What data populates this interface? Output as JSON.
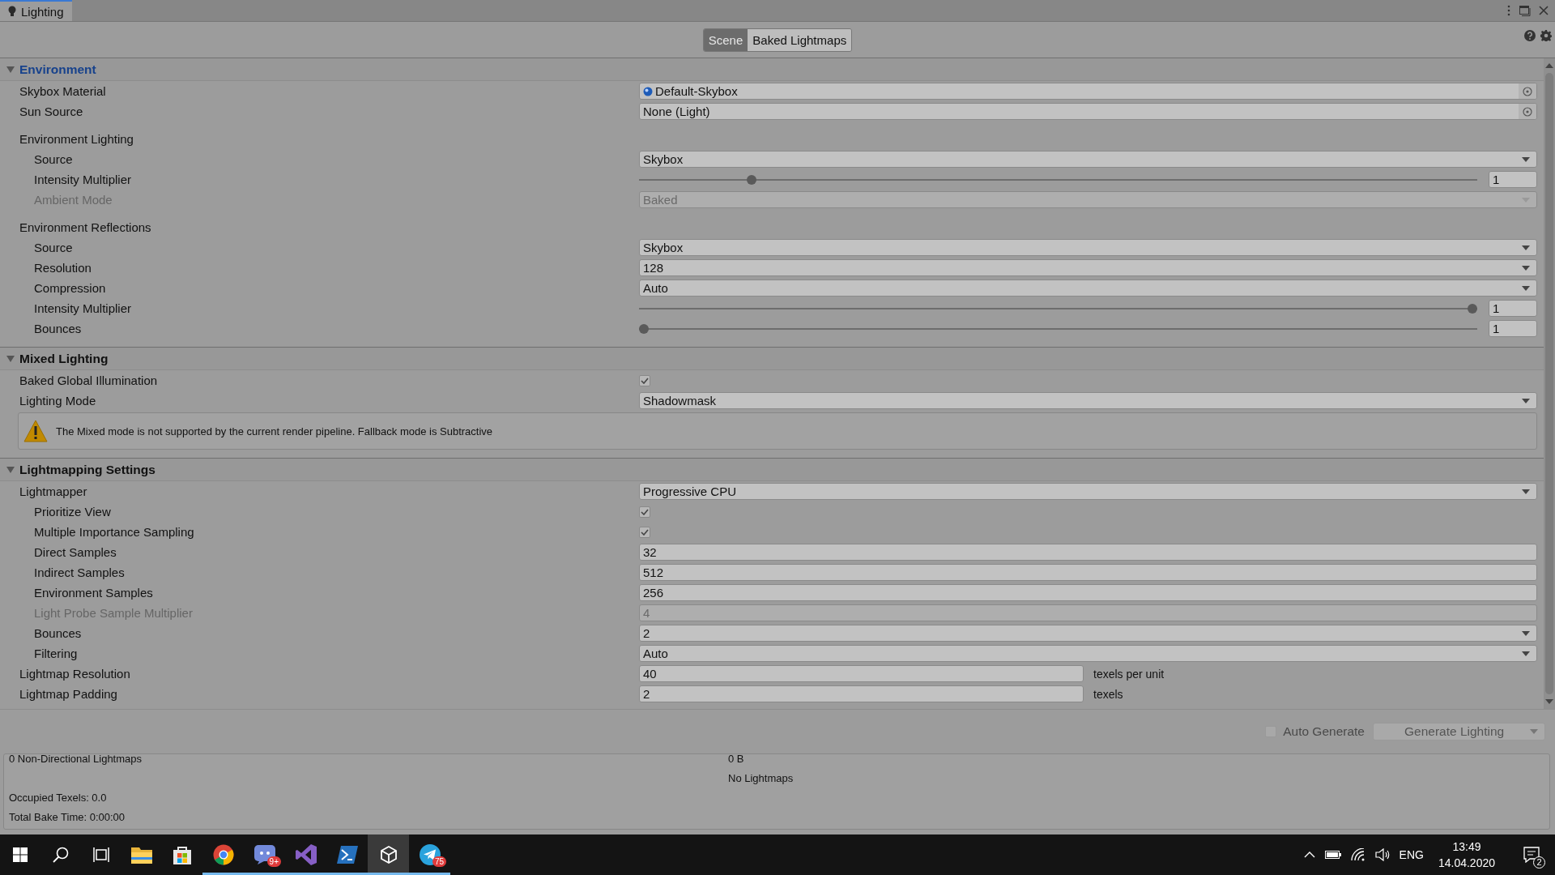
{
  "window": {
    "tab": {
      "label": "Lighting",
      "selected": true
    }
  },
  "toolbar": {
    "tabs": [
      {
        "label": "Scene",
        "selected": true
      },
      {
        "label": "Baked Lightmaps",
        "selected": false
      }
    ]
  },
  "sections": [
    {
      "title": "Environment",
      "expanded": true,
      "selected": true,
      "rows": [
        {
          "kind": "object",
          "label": "Skybox Material",
          "value": "Default-Skybox",
          "has_icon": true,
          "disabled": false
        },
        {
          "kind": "object",
          "label": "Sun Source",
          "value": "None (Light)",
          "has_icon": false,
          "disabled": false
        },
        {
          "kind": "heading",
          "label": "Environment Lighting",
          "disabled": false,
          "children": [
            {
              "kind": "dropdown",
              "label": "Source",
              "value": "Skybox",
              "disabled": false
            },
            {
              "kind": "slider",
              "label": "Intensity Multiplier",
              "level": 0.13,
              "value": "1",
              "disabled": false
            },
            {
              "kind": "dropdown",
              "label": "Ambient Mode",
              "value": "Baked",
              "disabled": true
            }
          ]
        },
        {
          "kind": "heading",
          "label": "Environment Reflections",
          "disabled": false,
          "children": [
            {
              "kind": "dropdown",
              "label": "Source",
              "value": "Skybox",
              "disabled": false
            },
            {
              "kind": "dropdown",
              "label": "Resolution",
              "value": "128",
              "disabled": false
            },
            {
              "kind": "dropdown",
              "label": "Compression",
              "value": "Auto",
              "disabled": false
            },
            {
              "kind": "slider",
              "label": "Intensity Multiplier",
              "level": 1,
              "value": "1",
              "disabled": false
            },
            {
              "kind": "slider",
              "label": "Bounces",
              "level": 0,
              "value": "1",
              "disabled": false
            }
          ]
        }
      ]
    },
    {
      "title": "Mixed Lighting",
      "expanded": true,
      "selected": false,
      "rows": [
        {
          "kind": "checkbox",
          "label": "Baked Global Illumination",
          "checked": true,
          "disabled": false
        },
        {
          "kind": "dropdown",
          "label": "Lighting Mode",
          "value": "Shadowmask",
          "disabled": false
        },
        {
          "kind": "warning",
          "text": "The Mixed mode is not supported by the current render pipeline. Fallback mode is Subtractive"
        }
      ]
    },
    {
      "title": "Lightmapping Settings",
      "expanded": true,
      "selected": false,
      "rows": [
        {
          "kind": "dropdown",
          "label": "Lightmapper",
          "value": "Progressive CPU",
          "disabled": false,
          "children": [
            {
              "kind": "checkbox",
              "label": "Prioritize View",
              "checked": true,
              "disabled": false
            },
            {
              "kind": "checkbox",
              "label": "Multiple Importance Sampling",
              "checked": true,
              "disabled": false
            },
            {
              "kind": "number",
              "label": "Direct Samples",
              "value": "32",
              "disabled": false
            },
            {
              "kind": "number",
              "label": "Indirect Samples",
              "value": "512",
              "disabled": false
            },
            {
              "kind": "number",
              "label": "Environment Samples",
              "value": "256",
              "disabled": false
            },
            {
              "kind": "number",
              "label": "Light Probe Sample Multiplier",
              "value": "4",
              "disabled": true
            },
            {
              "kind": "dropdown",
              "label": "Bounces",
              "value": "2",
              "disabled": false
            },
            {
              "kind": "dropdown",
              "label": "Filtering",
              "value": "Auto",
              "disabled": false
            }
          ]
        },
        {
          "kind": "number",
          "label": "Lightmap Resolution",
          "value": "40",
          "suffix": "texels per unit",
          "disabled": false
        },
        {
          "kind": "number",
          "label": "Lightmap Padding",
          "value": "2",
          "suffix": "texels",
          "disabled": false
        }
      ]
    }
  ],
  "footer": {
    "auto_generate": {
      "label": "Auto Generate",
      "checked": false
    },
    "generate_button": {
      "label": "Generate Lighting",
      "disabled": true
    }
  },
  "stats": [
    {
      "label": "0 Non-Directional Lightmaps",
      "value": "0 B"
    },
    {
      "value": "No Lightmaps"
    },
    {
      "label": "Occupied Texels: 0.0"
    },
    {
      "label": "Total Bake Time: 0:00:00"
    }
  ],
  "taskbar": {
    "apps": [
      {
        "kind": "start",
        "running": false,
        "active": false
      },
      {
        "kind": "search",
        "running": false,
        "active": false
      },
      {
        "kind": "taskview",
        "running": false,
        "active": false
      },
      {
        "kind": "folder",
        "running": false,
        "active": false
      },
      {
        "kind": "bag",
        "running": false,
        "active": false
      },
      {
        "kind": "browser",
        "running": true,
        "active": false
      },
      {
        "kind": "chat",
        "running": true,
        "active": false,
        "badge": "9+"
      },
      {
        "kind": "ribbon",
        "running": true,
        "active": false
      },
      {
        "kind": "prompt",
        "running": true,
        "active": false
      },
      {
        "kind": "cube",
        "running": true,
        "active": true
      },
      {
        "kind": "plane",
        "running": true,
        "active": false,
        "badge": "75"
      }
    ],
    "language": "ENG",
    "time": "13:49",
    "date": "14.04.2020",
    "notifications": "2"
  }
}
